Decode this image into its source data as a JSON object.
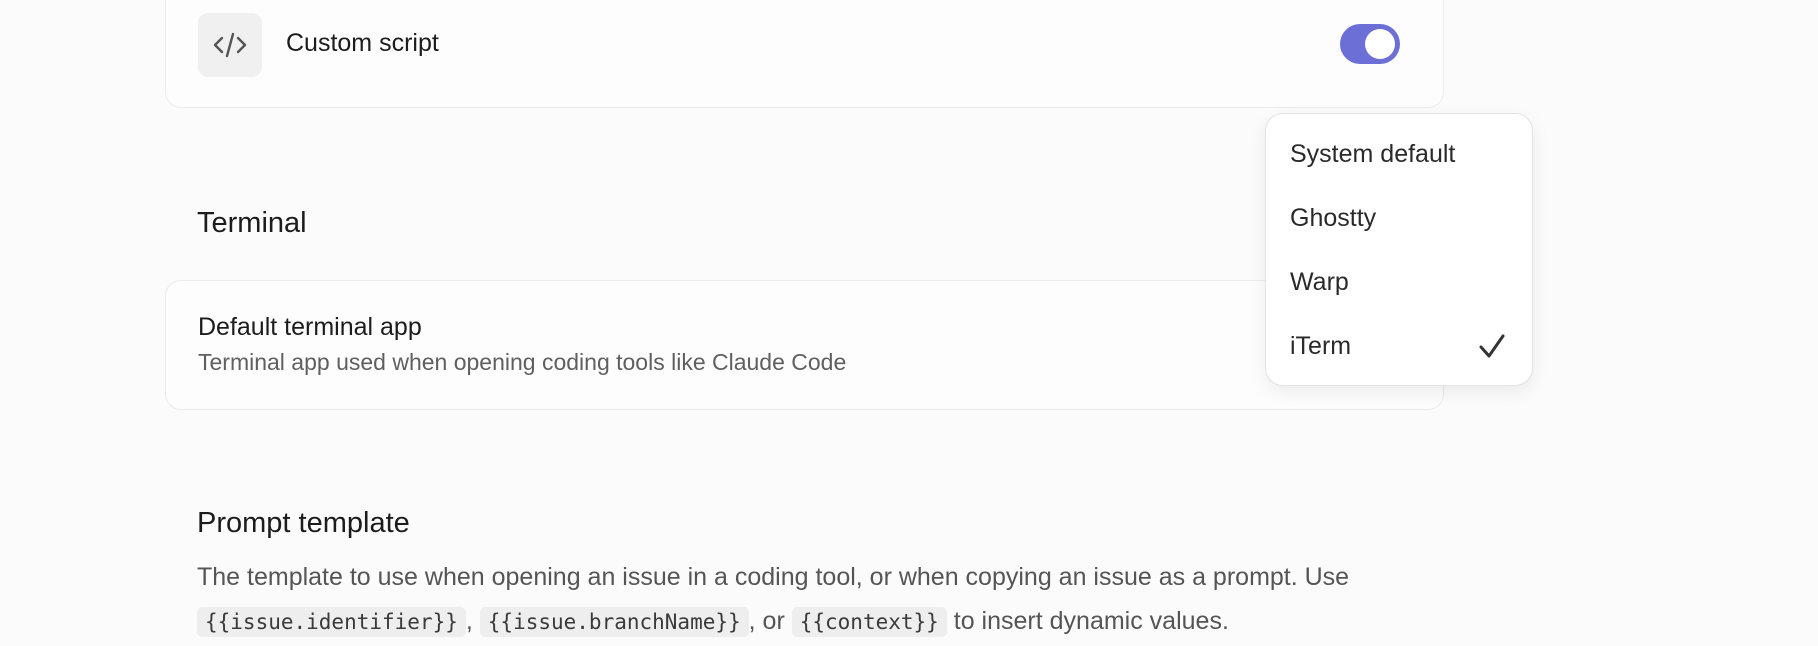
{
  "custom_script": {
    "icon": "code-icon",
    "label": "Custom script",
    "toggle_on": true,
    "accent_color": "#6b6fd6"
  },
  "terminal": {
    "section_title": "Terminal",
    "default_app_title": "Default terminal app",
    "default_app_description": "Terminal app used when opening coding tools like Claude Code"
  },
  "terminal_dropdown": {
    "options": [
      "System default",
      "Ghostty",
      "Warp",
      "iTerm"
    ],
    "selected": "iTerm",
    "check_icon": "checkmark-icon"
  },
  "prompt_template": {
    "section_title": "Prompt template",
    "description_prefix": "The template to use when opening an issue in a coding tool, or when copying an issue as a prompt. Use",
    "var_identifier": "{{issue.identifier}}",
    "sep1": ",",
    "var_branch": "{{issue.branchName}}",
    "sep2": ", or",
    "var_context": "{{context}}",
    "description_suffix": "to insert dynamic values."
  }
}
